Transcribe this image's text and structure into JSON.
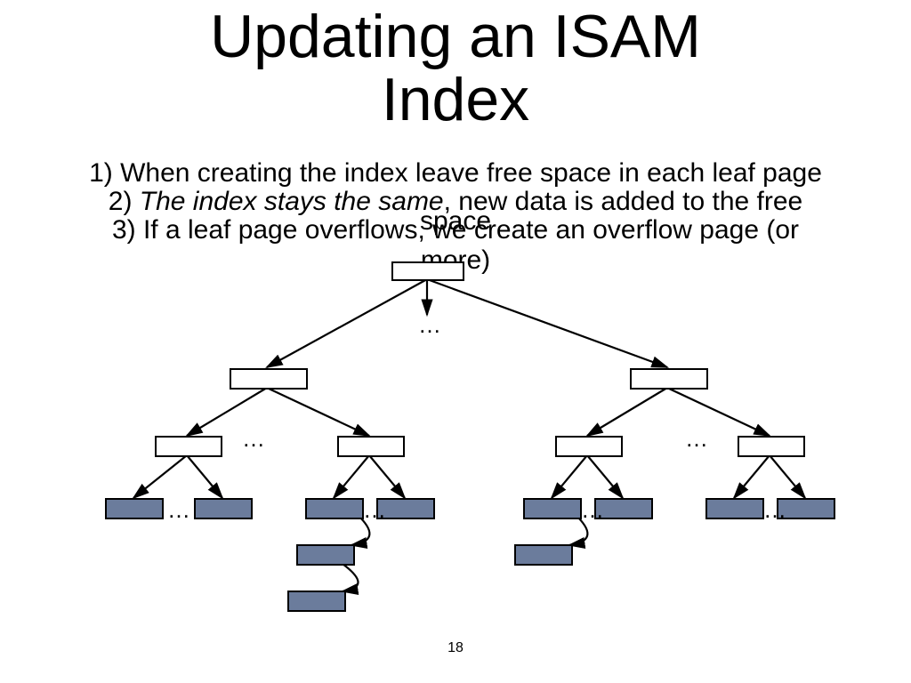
{
  "title": "Updating an ISAM\nIndex",
  "bullets": {
    "b1": "1) When creating the index leave free space in each leaf page",
    "b2_prefix": "2) ",
    "b2_ital": "The index stays the same",
    "b2_rest": ", new data is added to the free",
    "b2_space": "space",
    "b3": "3) If a leaf page overflows, we create an overflow page (or",
    "b3_more": "more)"
  },
  "slidenum": "18",
  "dots": "…",
  "chart_data": {
    "type": "tree",
    "description": "ISAM index tree with a root, two internal levels, leaf pages, and two overflow chains",
    "colors": {
      "index_node": "#ffffff",
      "leaf_node": "#6b7c9c",
      "border": "#000000"
    },
    "root": {
      "id": "root"
    },
    "level1": [
      {
        "id": "L1a"
      },
      {
        "id": "L1b"
      }
    ],
    "level2": [
      {
        "id": "L2a",
        "parent": "L1a"
      },
      {
        "id": "L2b",
        "parent": "L1a"
      },
      {
        "id": "L2c",
        "parent": "L1b"
      },
      {
        "id": "L2d",
        "parent": "L1b"
      }
    ],
    "leaves": [
      {
        "id": "leaf1",
        "parent": "L2a"
      },
      {
        "id": "leaf2",
        "parent": "L2a"
      },
      {
        "id": "leaf3",
        "parent": "L2b"
      },
      {
        "id": "leaf4",
        "parent": "L2b"
      },
      {
        "id": "leaf5",
        "parent": "L2c"
      },
      {
        "id": "leaf6",
        "parent": "L2c"
      },
      {
        "id": "leaf7",
        "parent": "L2d"
      },
      {
        "id": "leaf8",
        "parent": "L2d"
      }
    ],
    "overflow_chains": [
      {
        "from": "leaf3",
        "chain": [
          "ov1",
          "ov2"
        ]
      },
      {
        "from": "leaf5",
        "chain": [
          "ov3"
        ]
      }
    ]
  }
}
